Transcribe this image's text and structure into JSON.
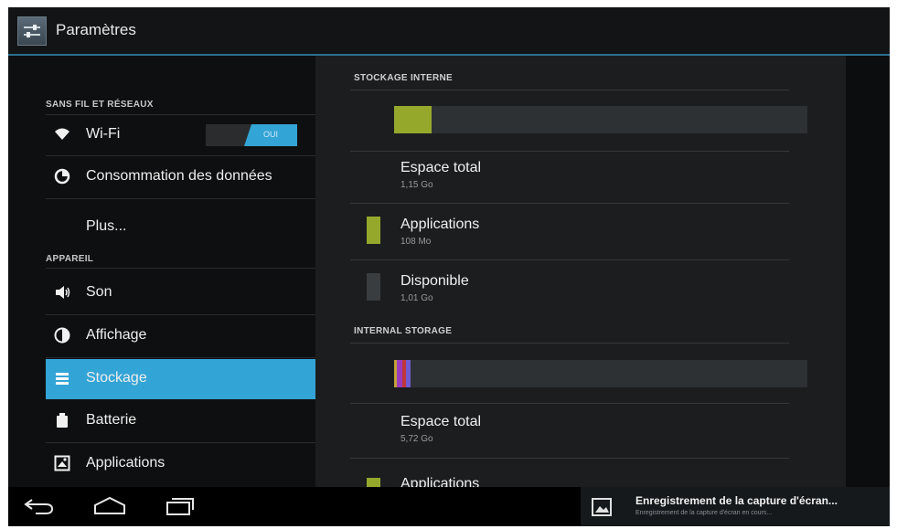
{
  "header": {
    "title": "Paramètres",
    "icon": "settings-app-icon"
  },
  "left": {
    "section_wireless": "SANS FIL ET RÉSEAUX",
    "wifi": {
      "label": "Wi-Fi",
      "toggle": "OUI",
      "icon": "wifi-icon"
    },
    "data_usage": {
      "label": "Consommation des données",
      "icon": "data-usage-icon"
    },
    "more": {
      "label": "Plus..."
    },
    "section_device": "APPAREIL",
    "items": [
      {
        "label": "Son",
        "icon": "volume-icon"
      },
      {
        "label": "Affichage",
        "icon": "display-icon"
      },
      {
        "label": "Stockage",
        "icon": "storage-icon",
        "selected": true
      },
      {
        "label": "Batterie",
        "icon": "battery-icon"
      },
      {
        "label": "Applications",
        "icon": "apps-icon"
      }
    ]
  },
  "storage": {
    "internal": {
      "header": "STOCKAGE INTERNE",
      "used_fraction": 0.09,
      "total": {
        "label": "Espace total",
        "value": "1,15 Go"
      },
      "apps": {
        "label": "Applications",
        "value": "108 Mo",
        "color": "#95a82c"
      },
      "available": {
        "label": "Disponible",
        "value": "1,01 Go",
        "color": "#3a3d40"
      }
    },
    "internal2": {
      "header": "INTERNAL STORAGE",
      "segments": [
        {
          "color": "#c4a03a",
          "fraction": 0.006
        },
        {
          "color": "#9a3bbd",
          "fraction": 0.013
        },
        {
          "color": "#c0363a",
          "fraction": 0.01
        },
        {
          "color": "#6f5bd2",
          "fraction": 0.01
        }
      ],
      "total": {
        "label": "Espace total",
        "value": "5,72 Go"
      },
      "apps": {
        "label": "Applications",
        "color": "#95a82c"
      }
    }
  },
  "notification": {
    "title": "Enregistrement de la capture d'écran...",
    "subtitle": "Enregistrement de la capture d'écran en cours...",
    "icon": "picture-icon"
  },
  "nav": {
    "back": "back-icon",
    "home": "home-icon",
    "recents": "recents-icon"
  }
}
